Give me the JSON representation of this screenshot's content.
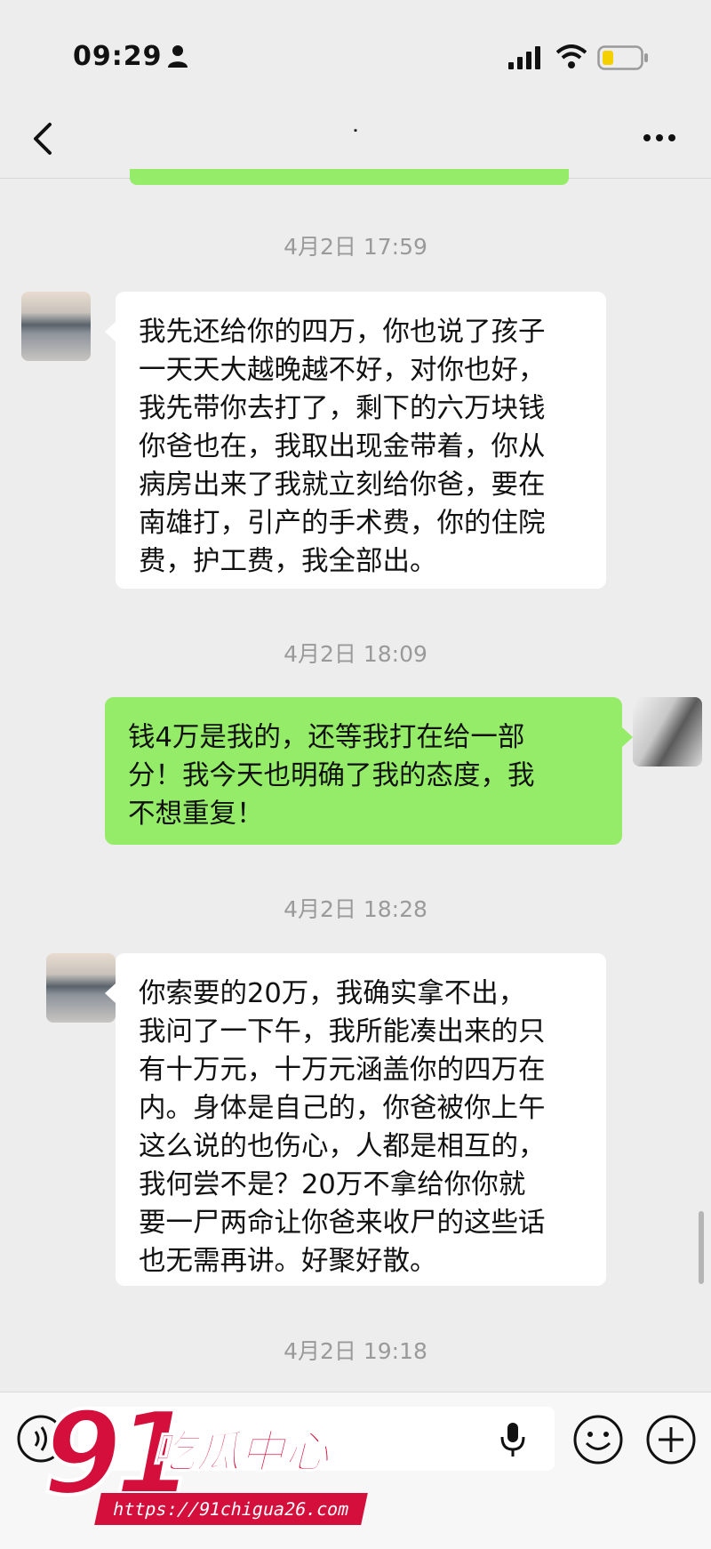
{
  "status_bar": {
    "time": "09:29",
    "icons": [
      "person-icon",
      "signal-icon",
      "wifi-icon",
      "battery-icon"
    ],
    "battery_color": "#f5d000"
  },
  "nav": {
    "title": "˙",
    "back_icon": "chevron-left-icon",
    "more_icon": "ellipsis-icon"
  },
  "colors": {
    "background": "#ededed",
    "bubble_sent": "#95ec69",
    "bubble_received": "#ffffff",
    "timestamp": "#9a9a9a",
    "watermark": "#d40f3c"
  },
  "messages": [
    {
      "type": "timestamp",
      "text": "4月2日 17:59"
    },
    {
      "type": "received",
      "lines": [
        "我先还给你的四万，你也说了孩子",
        "一天天大越晚越不好，对你也好，",
        "我先带你去打了，剩下的六万块钱",
        "你爸也在，我取出现金带着，你从",
        "病房出来了我就立刻给你爸，要在",
        "南雄打，引产的手术费，你的住院",
        "费，护工费，我全部出。"
      ]
    },
    {
      "type": "timestamp",
      "text": "4月2日 18:09"
    },
    {
      "type": "sent",
      "lines": [
        "钱4万是我的，还等我打在给一部",
        "分！我今天也明确了我的态度，我",
        "不想重复！"
      ]
    },
    {
      "type": "timestamp",
      "text": "4月2日 18:28"
    },
    {
      "type": "received",
      "lines": [
        "你索要的20万，我确实拿不出，",
        "我问了一下午，我所能凑出来的只",
        "有十万元，十万元涵盖你的四万在",
        "内。身体是自己的，你爸被你上午",
        "这么说的也伤心，人都是相互的，",
        "我何尝不是？20万不拿给你你就",
        "要一尸两命让你爸来收尸的这些话",
        "也无需再讲。好聚好散。"
      ]
    },
    {
      "type": "timestamp",
      "text": "4月2日 19:18"
    }
  ],
  "input_bar": {
    "icons": [
      "voice-icon",
      "microphone-icon",
      "emoji-icon",
      "plus-icon"
    ]
  },
  "watermark": {
    "number": "91",
    "text": "吃瓜中心",
    "url": "https://91chigua26.com"
  }
}
